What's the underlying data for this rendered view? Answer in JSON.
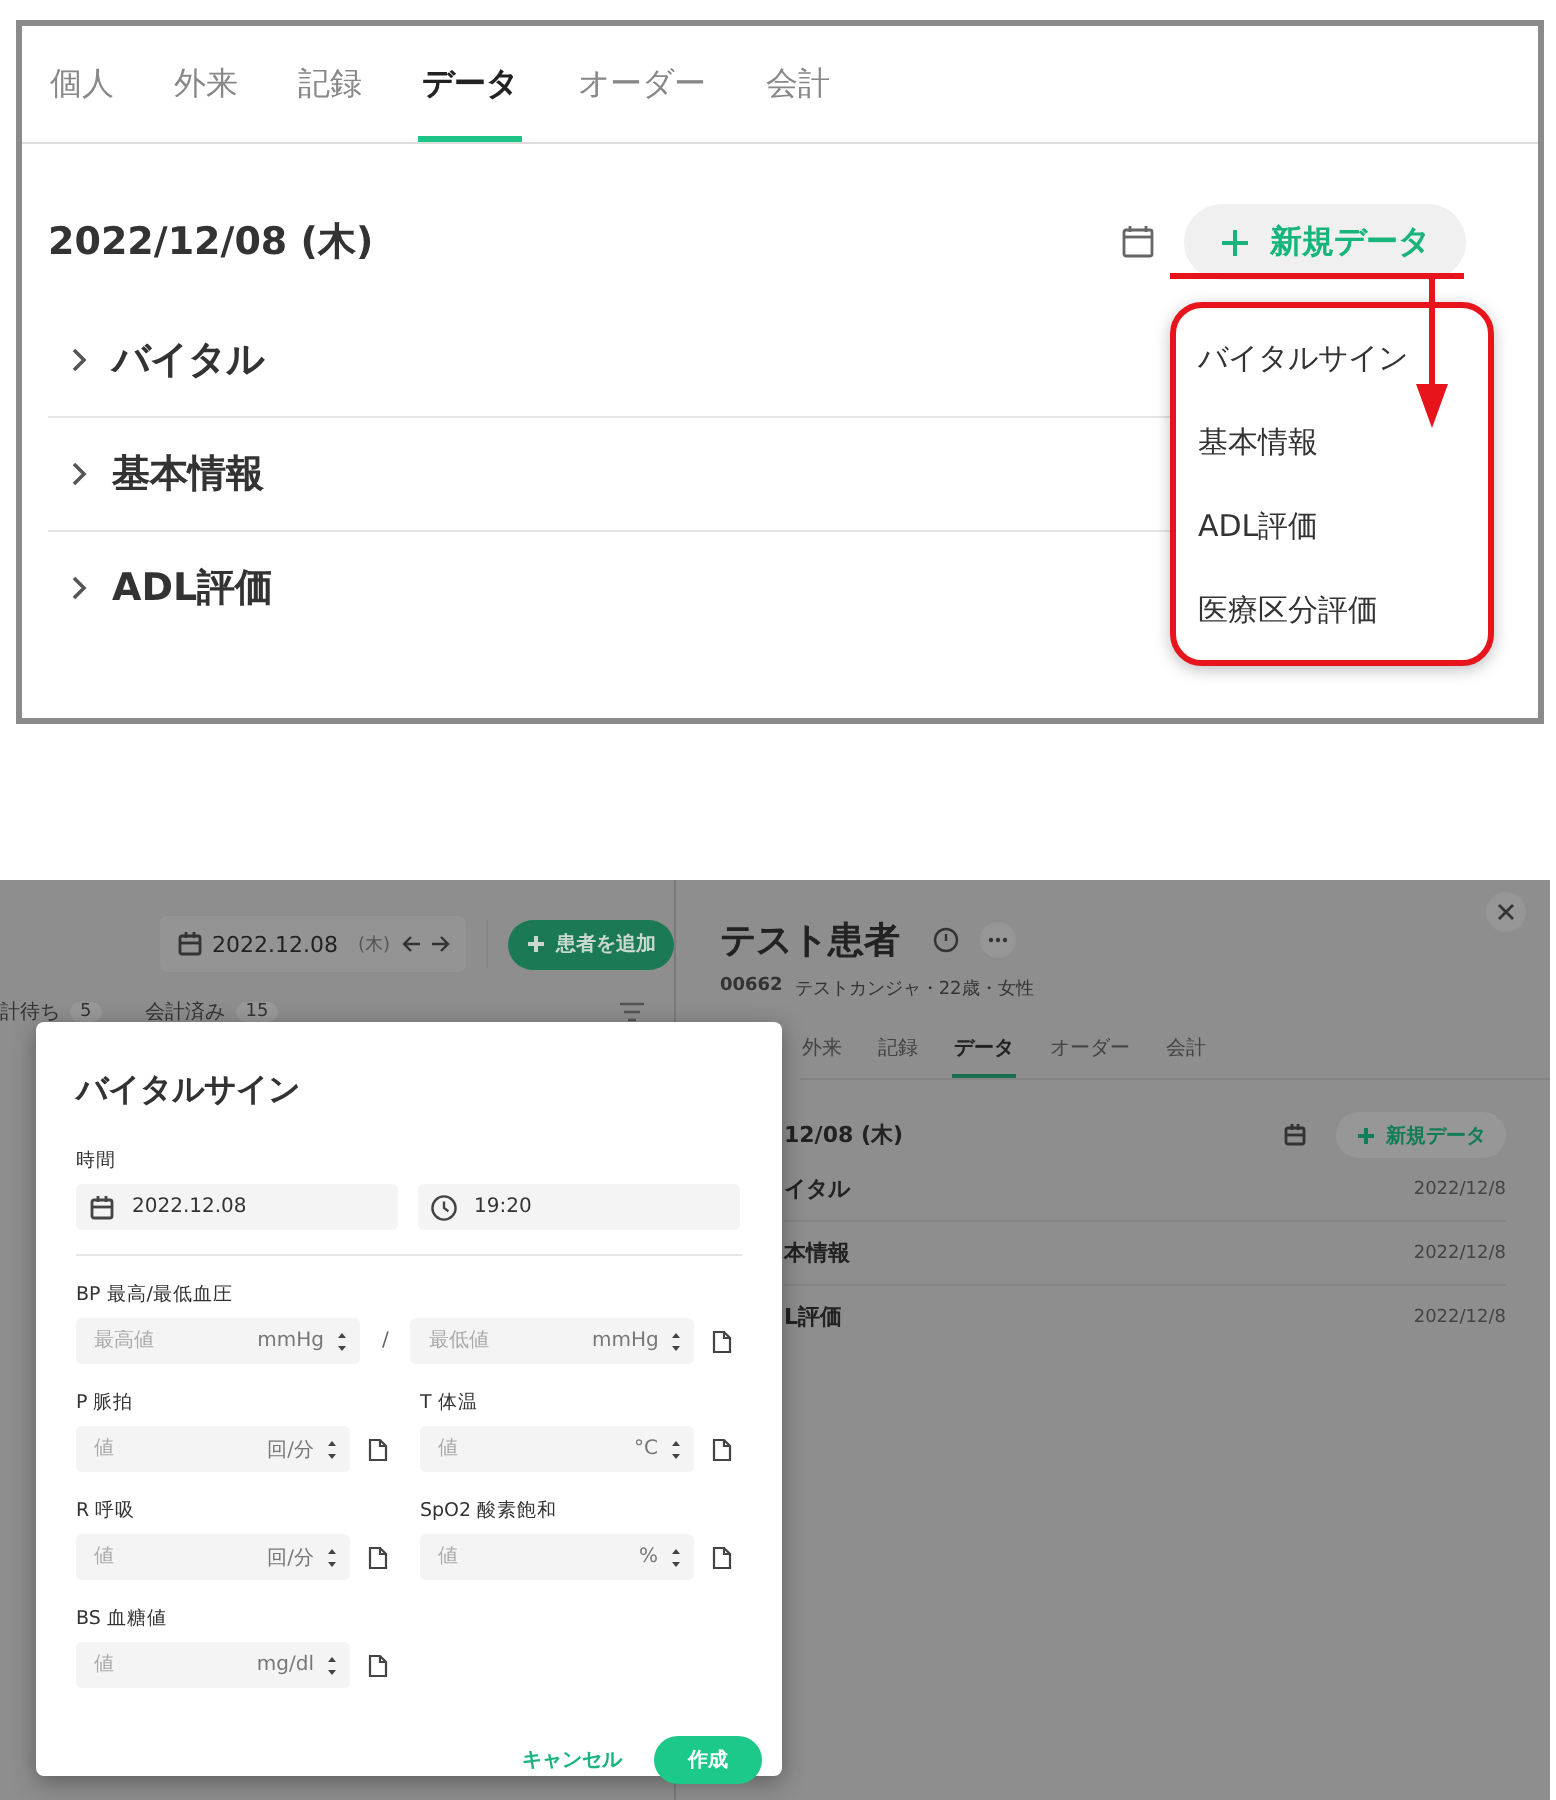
{
  "top": {
    "tabs": [
      {
        "label": "個人",
        "selected": false
      },
      {
        "label": "外来",
        "selected": false
      },
      {
        "label": "記録",
        "selected": false
      },
      {
        "label": "データ",
        "selected": true
      },
      {
        "label": "オーダー",
        "selected": false
      },
      {
        "label": "会計",
        "selected": false
      }
    ],
    "date": "2022/12/08 (木)",
    "new_button": "新規データ",
    "sections": [
      {
        "label": "バイタル",
        "expanded": false
      },
      {
        "label": "基本情報",
        "expanded": false
      },
      {
        "label": "ADL評価",
        "expanded": false
      }
    ],
    "menu": [
      {
        "label": "バイタルサイン"
      },
      {
        "label": "基本情報"
      },
      {
        "label": "ADL評価"
      },
      {
        "label": "医療区分評価"
      }
    ]
  },
  "bottom": {
    "toolbar": {
      "date": "2022.12.08",
      "weekday": "(木)",
      "add_button": "患者を追加"
    },
    "counters": [
      {
        "label": "計待ち",
        "count": "5"
      },
      {
        "label": "会計済み",
        "count": "15"
      }
    ],
    "patient": {
      "name": "テスト患者",
      "id": "00662",
      "info": "テストカンジャ・22歳・女性"
    },
    "tabs": [
      {
        "label": "外来",
        "selected": false
      },
      {
        "label": "記録",
        "selected": false
      },
      {
        "label": "データ",
        "selected": true
      },
      {
        "label": "オーダー",
        "selected": false
      },
      {
        "label": "会計",
        "selected": false
      }
    ],
    "date": "12/08 (木)",
    "new_button": "新規データ",
    "records": [
      {
        "label": "イタル",
        "date": "2022/12/8"
      },
      {
        "label": "本情報",
        "date": "2022/12/8"
      },
      {
        "label": "L評価",
        "date": "2022/12/8"
      }
    ],
    "dialog": {
      "title": "バイタルサイン",
      "time_label": "時間",
      "date": "2022.12.08",
      "time": "19:20",
      "fields": [
        {
          "kind": "pair",
          "label": "BP 最高/最低血圧",
          "separator": "/",
          "inputs": [
            {
              "placeholder": "最高値",
              "unit": "mmHg"
            },
            {
              "placeholder": "最低値",
              "unit": "mmHg"
            }
          ]
        },
        {
          "kind": "single",
          "label": "P 脈拍",
          "placeholder": "値",
          "unit": "回/分"
        },
        {
          "kind": "single",
          "label": "T 体温",
          "placeholder": "値",
          "unit": "°C"
        },
        {
          "kind": "single",
          "label": "R 呼吸",
          "placeholder": "値",
          "unit": "回/分"
        },
        {
          "kind": "single",
          "label": "SpO2 酸素飽和",
          "placeholder": "値",
          "unit": "%"
        },
        {
          "kind": "single",
          "label": "BS 血糖値",
          "placeholder": "値",
          "unit": "mg/dl"
        }
      ],
      "cancel": "キャンセル",
      "submit": "作成"
    }
  }
}
